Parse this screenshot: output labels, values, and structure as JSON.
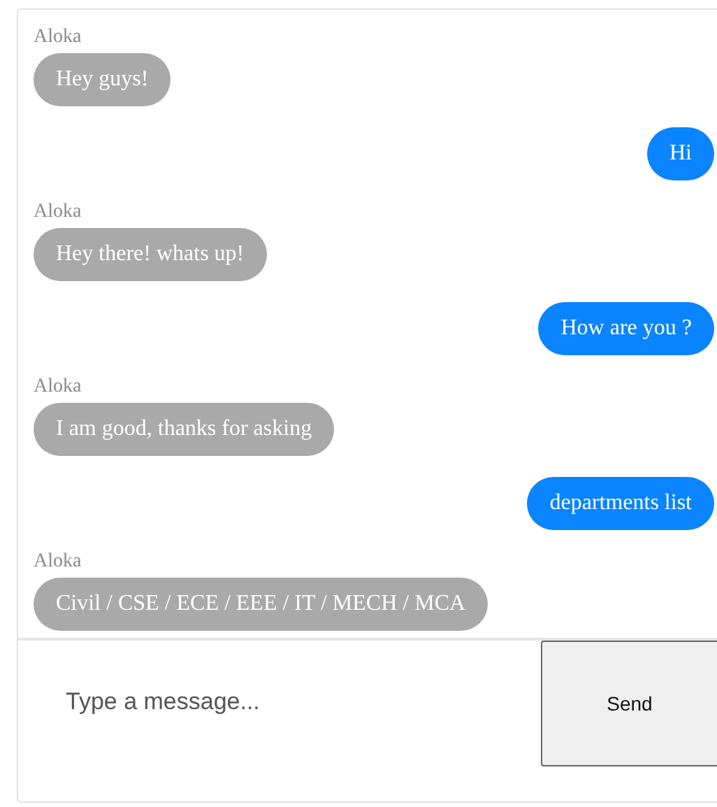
{
  "messages": [
    {
      "kind": "received",
      "sender": "Aloka",
      "text": "Hey guys!"
    },
    {
      "kind": "sent",
      "text": "Hi"
    },
    {
      "kind": "received",
      "sender": "Aloka",
      "text": "Hey there! whats up!"
    },
    {
      "kind": "sent",
      "text": "How are you ?"
    },
    {
      "kind": "received",
      "sender": "Aloka",
      "text": "I am good, thanks for asking"
    },
    {
      "kind": "sent",
      "text": "departments list"
    },
    {
      "kind": "received",
      "sender": "Aloka",
      "text": "Civil / CSE / ECE / EEE / IT / MECH / MCA"
    }
  ],
  "composer": {
    "placeholder": "Type a message...",
    "button": "Send"
  }
}
